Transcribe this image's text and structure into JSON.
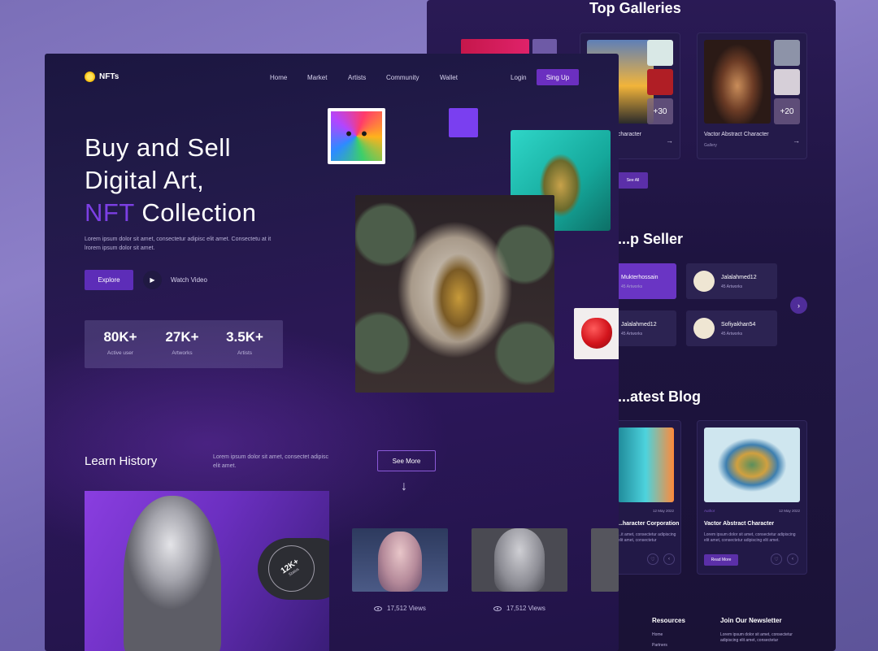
{
  "back": {
    "galleries_title": "Top Galleries",
    "galleries": [
      {
        "caption": "",
        "sub": ""
      },
      {
        "caption": "...character",
        "sub": "",
        "thumb_plus": "+30"
      },
      {
        "caption": "Vactor Abstract Character",
        "sub": "Gallery",
        "thumb_plus": "+20"
      }
    ],
    "see_all": "See All",
    "seller_title": "...p Seller",
    "sellers": [
      {
        "name": "Mukterhossain",
        "meta": "45 Artworks",
        "active": true
      },
      {
        "name": "Jalalahmed12",
        "meta": "45 Artworks"
      },
      {
        "name": "Jalalahmed12",
        "meta": "45 Artworks"
      },
      {
        "name": "Sofiyakhan54",
        "meta": "45 Artworks"
      }
    ],
    "blog_title": "...atest Blog",
    "blogs": [
      {
        "title": "...haracter Corporation",
        "date": "12 May 2022",
        "desc": "...it amet, consectetur adipiscing elit amet, consectetur",
        "tag": ""
      },
      {
        "title": "Vactor Abstract Character",
        "date": "12 May 2022",
        "desc": "Lorem ipsum dolor sit amet, consectetur adipiscing elit amet, consectetur adipiscing elit amet.",
        "tag": "Author",
        "read_more": "Read More"
      }
    ],
    "footer": {
      "resources_title": "Resources",
      "resources_links": [
        "Home",
        "Partners"
      ],
      "newsletter_title": "Join Our Newsletter",
      "newsletter_desc": "Lorem ipsum dolor sit amet, consectetur adipiscing elit amet, consectetur"
    }
  },
  "front": {
    "logo": "NFTs",
    "nav": [
      "Home",
      "Market",
      "Artists",
      "Community",
      "Wallet"
    ],
    "login": "Login",
    "signup": "Sing Up",
    "hero": {
      "line1": "Buy and Sell",
      "line2": "Digital Art,",
      "accent": "NFT",
      "line3_rest": " Collection",
      "desc": "Lorem ipsum dolor sit amet, consectetur adipisc elit amet. Consectetu at it lrorem ipsum dolor sit amet."
    },
    "explore": "Explore",
    "watch_video": "Watch Video",
    "stats": [
      {
        "value": "80K+",
        "label": "Active user"
      },
      {
        "value": "27K+",
        "label": "Artworks"
      },
      {
        "value": "3.5K+",
        "label": "Artists"
      }
    ],
    "learn_title": "Learn History",
    "learn_desc": "Lorem ipsum dolor sit amet, consectet adipisc elit amet.",
    "status_value": "12K+",
    "status_label": "Status",
    "see_more": "See More",
    "tiles": [
      {
        "views": "17,512 Views"
      },
      {
        "views": "17,512 Views"
      }
    ]
  },
  "colors": {
    "accent": "#7c3fe4",
    "button": "#5d2db8",
    "bg_dark": "#1b1640"
  }
}
